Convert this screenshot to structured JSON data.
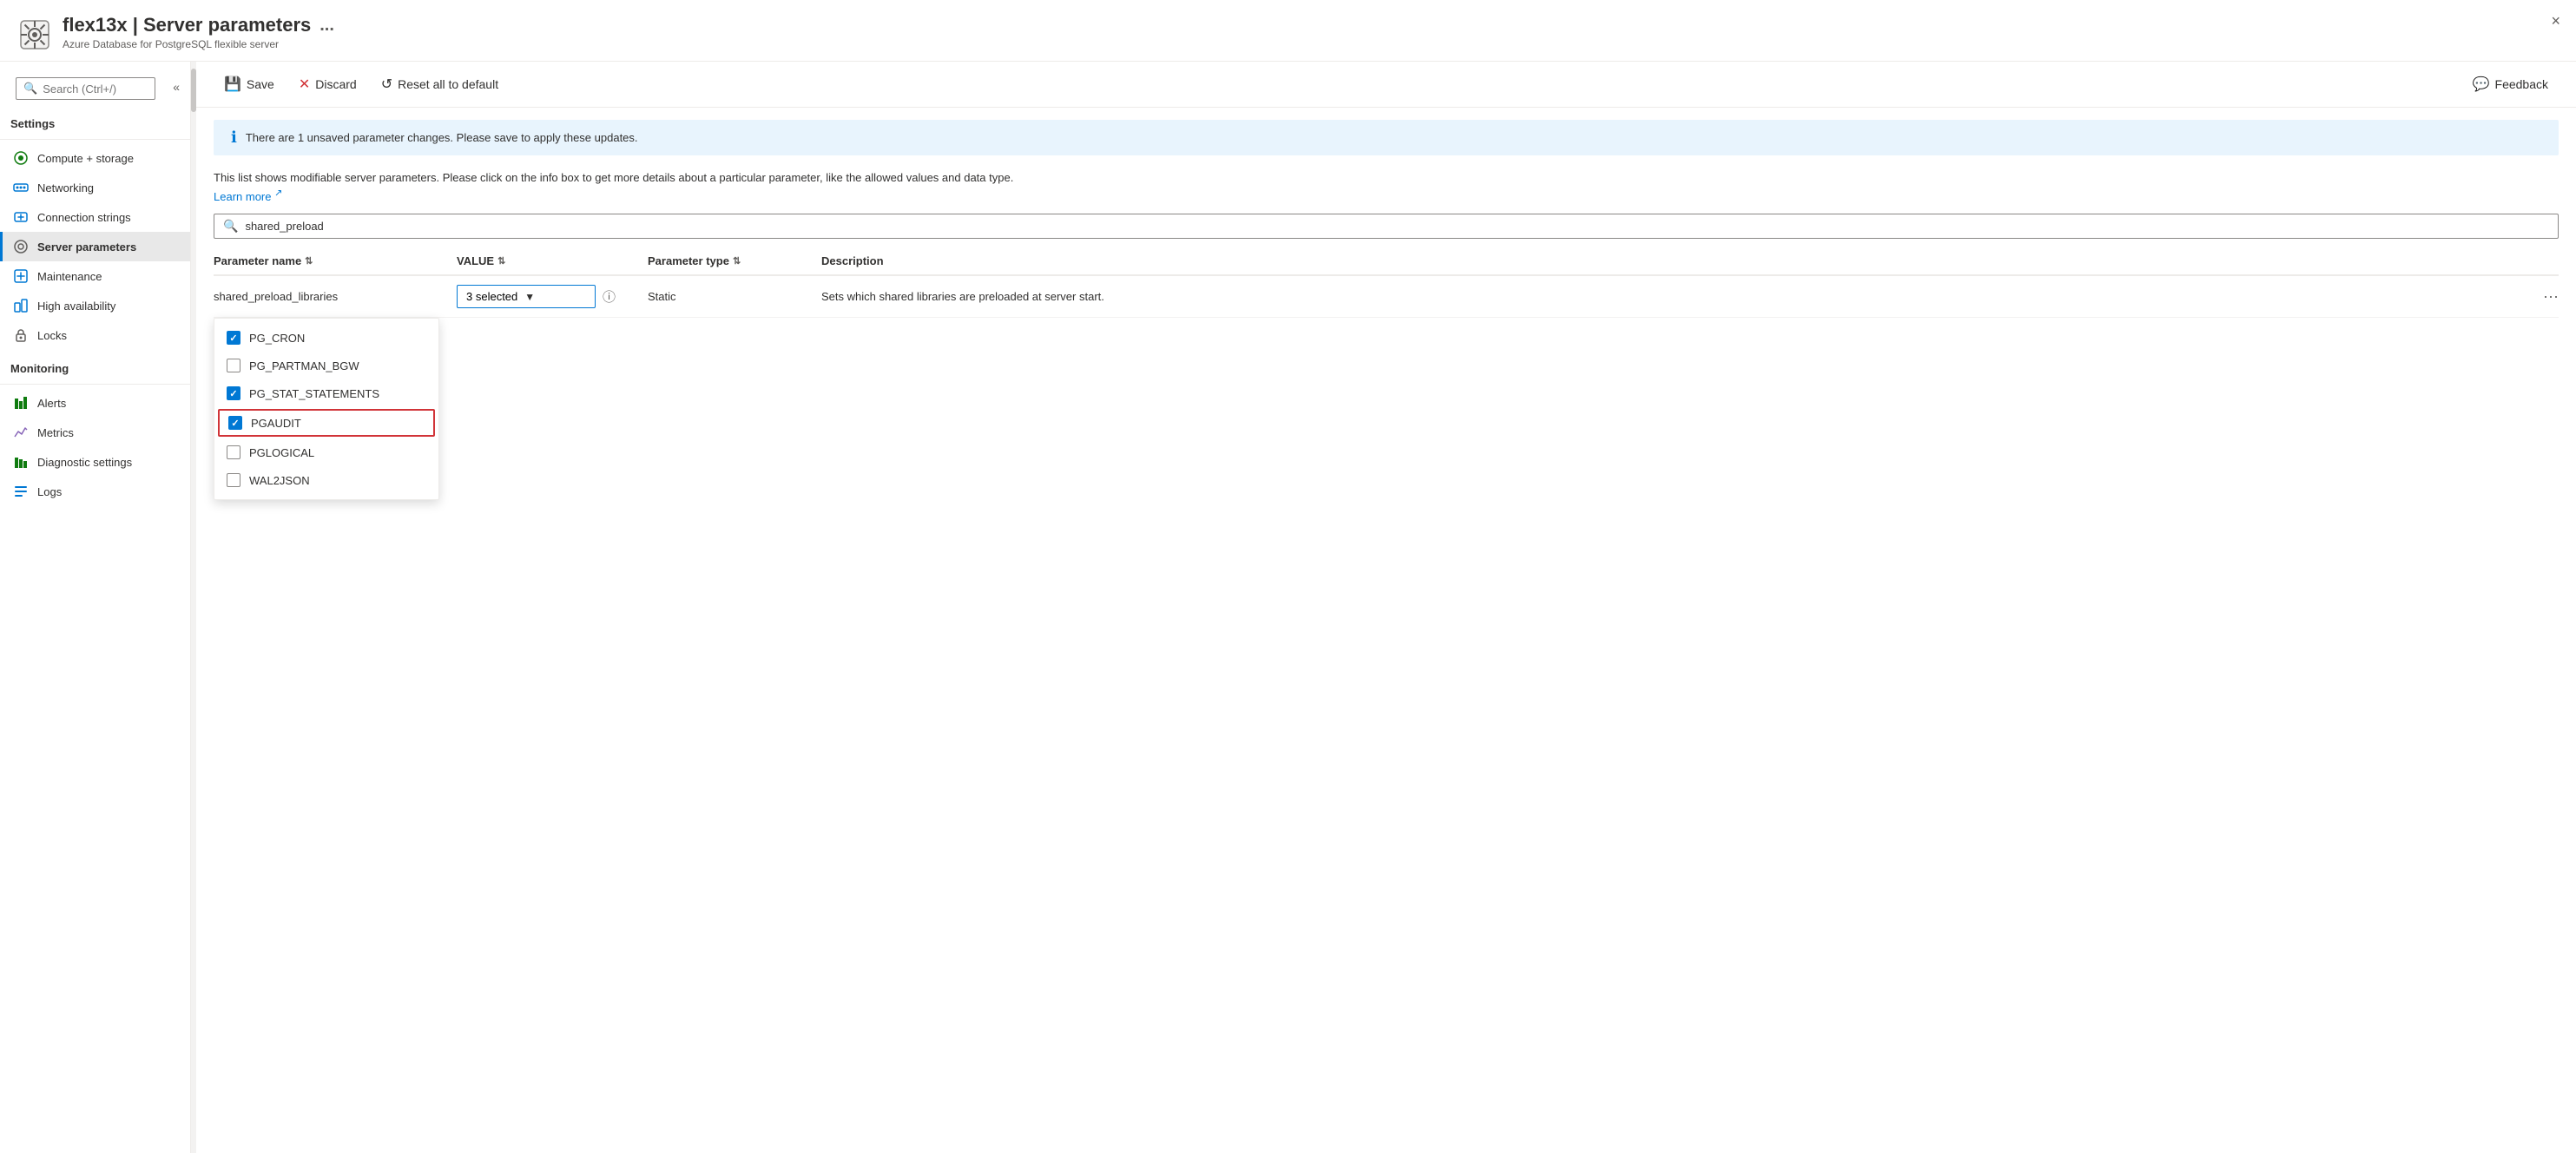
{
  "header": {
    "icon_label": "gear-icon",
    "title": "flex13x | Server parameters",
    "ellipsis": "...",
    "subtitle": "Azure Database for PostgreSQL flexible server",
    "close_label": "×"
  },
  "sidebar": {
    "search_placeholder": "Search (Ctrl+/)",
    "collapse_icon": "«",
    "sections": [
      {
        "label": "Settings",
        "items": [
          {
            "id": "compute-storage",
            "label": "Compute + storage",
            "icon": "compute-icon",
            "active": false
          },
          {
            "id": "networking",
            "label": "Networking",
            "icon": "networking-icon",
            "active": false
          },
          {
            "id": "connection-strings",
            "label": "Connection strings",
            "icon": "connection-icon",
            "active": false
          },
          {
            "id": "server-parameters",
            "label": "Server parameters",
            "icon": "server-params-icon",
            "active": true
          },
          {
            "id": "maintenance",
            "label": "Maintenance",
            "icon": "maintenance-icon",
            "active": false
          },
          {
            "id": "high-availability",
            "label": "High availability",
            "icon": "ha-icon",
            "active": false
          },
          {
            "id": "locks",
            "label": "Locks",
            "icon": "locks-icon",
            "active": false
          }
        ]
      },
      {
        "label": "Monitoring",
        "items": [
          {
            "id": "alerts",
            "label": "Alerts",
            "icon": "alerts-icon",
            "active": false
          },
          {
            "id": "metrics",
            "label": "Metrics",
            "icon": "metrics-icon",
            "active": false
          },
          {
            "id": "diagnostic-settings",
            "label": "Diagnostic settings",
            "icon": "diagnostic-icon",
            "active": false
          },
          {
            "id": "logs",
            "label": "Logs",
            "icon": "logs-icon",
            "active": false
          }
        ]
      }
    ]
  },
  "toolbar": {
    "save_label": "Save",
    "discard_label": "Discard",
    "reset_label": "Reset all to default",
    "feedback_label": "Feedback"
  },
  "banner": {
    "text": "There are 1 unsaved parameter changes.  Please save to apply these updates."
  },
  "description": {
    "text": "This list shows modifiable server parameters. Please click on the info box to get more details about a particular parameter, like the allowed values and data type.",
    "learn_more": "Learn more",
    "link_icon": "↗"
  },
  "filter": {
    "placeholder": "shared_preload"
  },
  "table": {
    "columns": [
      {
        "label": "Parameter name",
        "sortable": true
      },
      {
        "label": "VALUE",
        "sortable": true
      },
      {
        "label": "Parameter type",
        "sortable": true
      },
      {
        "label": "Description",
        "sortable": false
      }
    ],
    "rows": [
      {
        "param_name": "shared_preload_libraries",
        "value_display": "3 selected",
        "param_type": "Static",
        "description": "Sets which shared libraries are preloaded at server start."
      }
    ]
  },
  "dropdown": {
    "options": [
      {
        "id": "pg_cron",
        "label": "PG_CRON",
        "checked": true,
        "highlighted": false
      },
      {
        "id": "pg_partman_bgw",
        "label": "PG_PARTMAN_BGW",
        "checked": false,
        "highlighted": false
      },
      {
        "id": "pg_stat_statements",
        "label": "PG_STAT_STATEMENTS",
        "checked": true,
        "highlighted": false
      },
      {
        "id": "pgaudit",
        "label": "PGAUDIT",
        "checked": true,
        "highlighted": true
      },
      {
        "id": "pglogical",
        "label": "PGLOGICAL",
        "checked": false,
        "highlighted": false
      },
      {
        "id": "wal2json",
        "label": "WAL2JSON",
        "checked": false,
        "highlighted": false
      }
    ]
  },
  "colors": {
    "accent": "#0078d4",
    "danger": "#d13438",
    "checked_bg": "#0078d4",
    "banner_bg": "#e8f4fd"
  }
}
